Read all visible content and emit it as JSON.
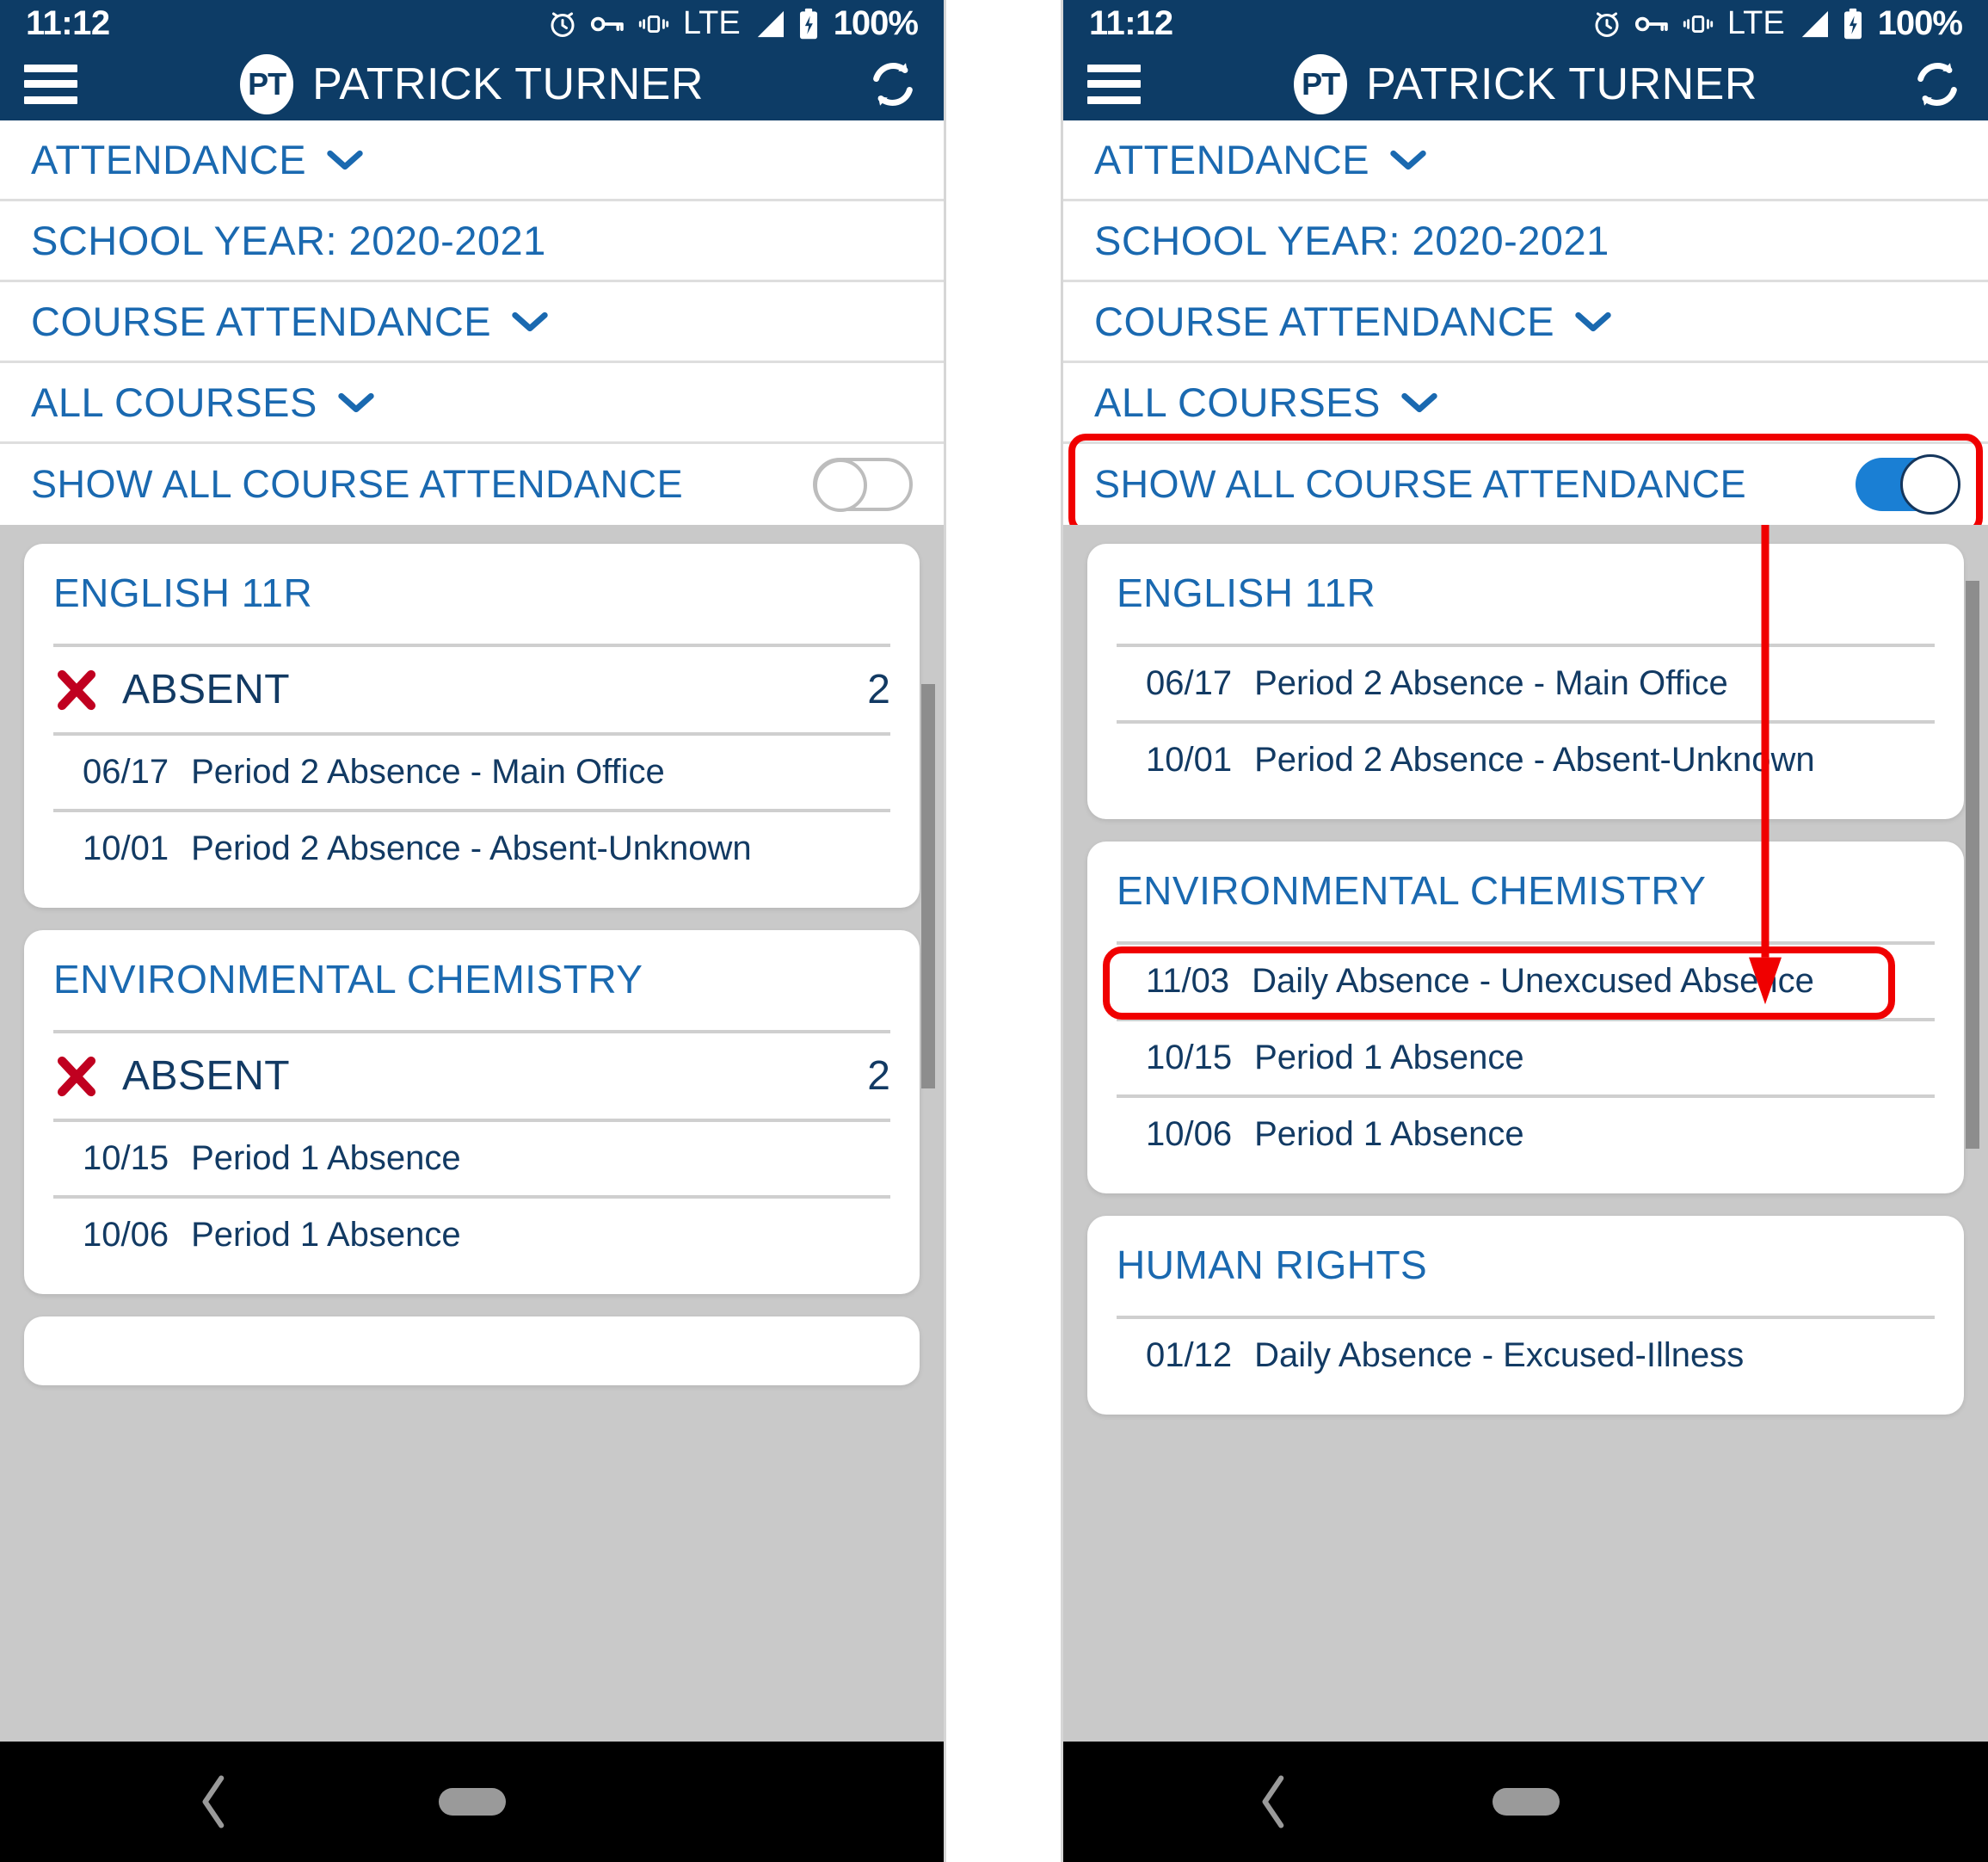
{
  "status_bar": {
    "time": "11:12",
    "battery_percent": "100%",
    "network": "LTE",
    "icons": [
      "alarm-icon",
      "vpn-key-icon",
      "vibrate-icon",
      "lte-label",
      "signal-icon",
      "battery-charging-icon"
    ]
  },
  "app_bar": {
    "menu_icon": "hamburger-menu-icon",
    "avatar_initials": "PT",
    "title": "PATRICK TURNER",
    "refresh_icon": "refresh-icon"
  },
  "filters": {
    "attendance": "ATTENDANCE",
    "school_year": "SCHOOL YEAR: 2020-2021",
    "course_attendance": "COURSE ATTENDANCE",
    "all_courses": "ALL COURSES",
    "show_all_label": "SHOW ALL COURSE ATTENDANCE"
  },
  "toggle": {
    "off_state": "off",
    "on_state": "on"
  },
  "absent_label": "ABSENT",
  "left_panel": {
    "show_all_enabled": false,
    "cards": [
      {
        "title": "ENGLISH 11R",
        "summary_label": "ABSENT",
        "summary_count": "2",
        "entries": [
          {
            "date": "06/17",
            "desc": "Period 2 Absence - Main Office"
          },
          {
            "date": "10/01",
            "desc": "Period 2 Absence - Absent-Unknown"
          }
        ]
      },
      {
        "title": "ENVIRONMENTAL CHEMISTRY",
        "summary_label": "ABSENT",
        "summary_count": "2",
        "entries": [
          {
            "date": "10/15",
            "desc": "Period 1 Absence"
          },
          {
            "date": "10/06",
            "desc": "Period 1 Absence"
          }
        ]
      }
    ]
  },
  "right_panel": {
    "show_all_enabled": true,
    "cards": [
      {
        "title": "ENGLISH 11R",
        "entries": [
          {
            "date": "06/17",
            "desc": "Period 2 Absence - Main Office"
          },
          {
            "date": "10/01",
            "desc": "Period 2 Absence - Absent-Unknown"
          }
        ]
      },
      {
        "title": "ENVIRONMENTAL CHEMISTRY",
        "entries": [
          {
            "date": "11/03",
            "desc": "Daily Absence - Unexcused Absence",
            "highlighted": true
          },
          {
            "date": "10/15",
            "desc": "Period 1 Absence"
          },
          {
            "date": "10/06",
            "desc": "Period 1 Absence"
          }
        ]
      },
      {
        "title": "HUMAN RIGHTS",
        "entries": [
          {
            "date": "01/12",
            "desc": "Daily Absence - Excused-Illness"
          }
        ]
      }
    ]
  },
  "annotations": {
    "highlight_color": "#f00000",
    "toggle_highlight_target": "show-all-course-attendance-toggle-row",
    "entry_highlight_target": "11/03 Daily Absence - Unexcused Absence",
    "arrow": "red-down-arrow"
  },
  "colors": {
    "header_blue": "#0d3c66",
    "link_blue": "#1a69b0",
    "text_navy": "#123a63",
    "toggle_on_blue": "#1a7fd4",
    "x_red": "#c00020",
    "content_gray": "#c9c9c9",
    "divider_gray": "#cfcfcf"
  },
  "nav_bar": {
    "back_icon": "back-chevron-icon",
    "home_icon": "home-pill-icon"
  }
}
